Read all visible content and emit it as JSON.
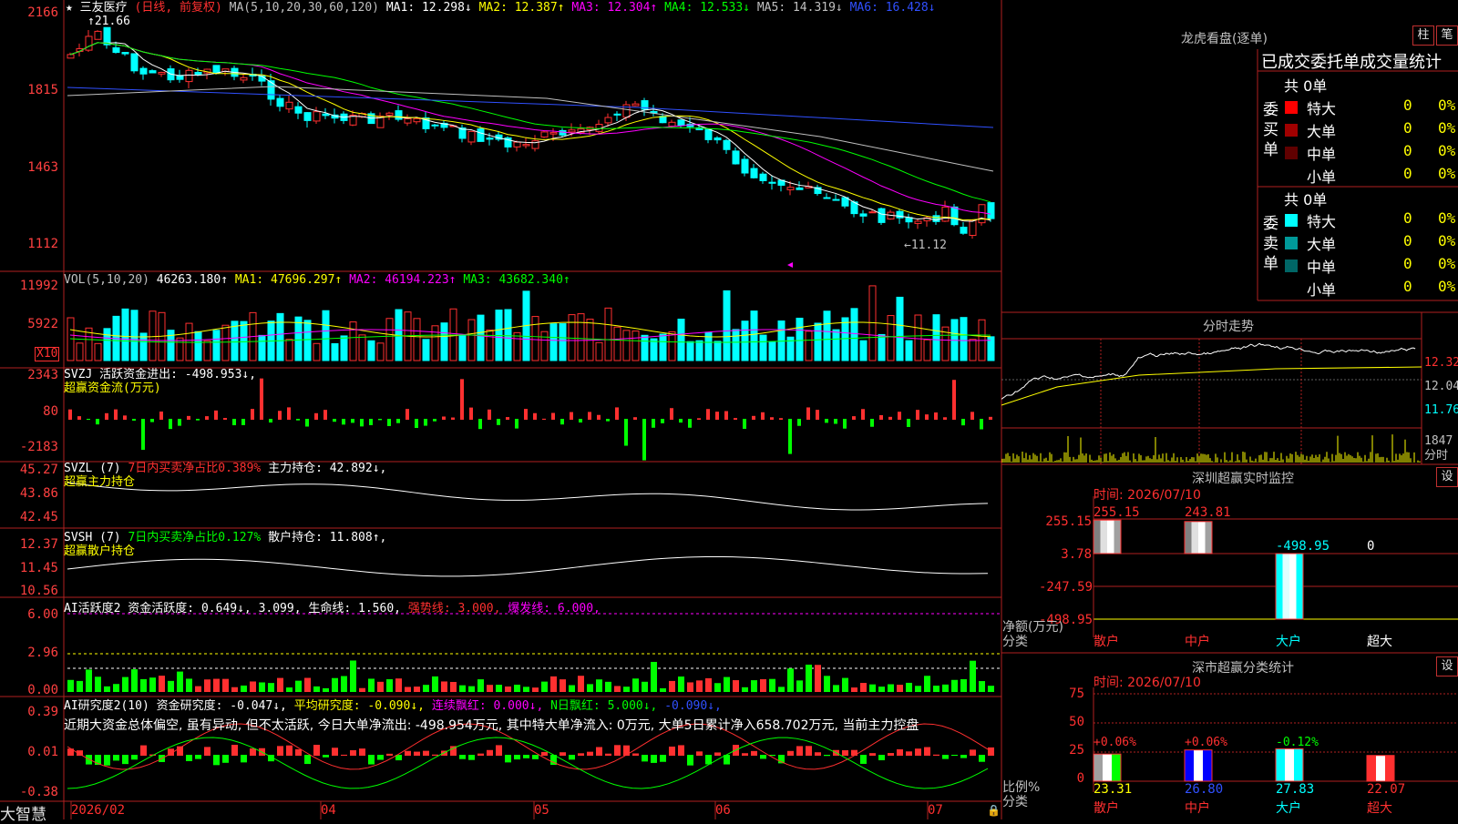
{
  "app": {
    "brand": "大智慧"
  },
  "kline": {
    "stock_name": "三友医疗",
    "period": "(日线, 前复权)",
    "ma_header": "MA(5,10,20,30,60,120)",
    "ma_items": [
      {
        "text": "MA1: 12.298↓",
        "color": "#ffffff"
      },
      {
        "text": "MA2: 12.387↑",
        "color": "#ffff00"
      },
      {
        "text": "MA3: 12.304↑",
        "color": "#ff00ff"
      },
      {
        "text": "MA4: 12.533↓",
        "color": "#00ff00"
      },
      {
        "text": "MA5: 14.319↓",
        "color": "#c0c0c0"
      },
      {
        "text": "MA6: 16.428↓",
        "color": "#3050ff"
      }
    ],
    "y_ticks": [
      "2166",
      "1815",
      "1463",
      "1112"
    ],
    "high_label": "21.66",
    "low_label": "←11.12"
  },
  "vol": {
    "header": "VOL(5,10,20)",
    "value": "46263.180↑",
    "ma_items": [
      {
        "text": "MA1: 47696.297↑",
        "color": "#ffff00"
      },
      {
        "text": "MA2: 46194.223↑",
        "color": "#ff00ff"
      },
      {
        "text": "MA3: 43682.340↑",
        "color": "#00ff00"
      }
    ],
    "y_ticks": [
      "11992",
      "5922"
    ],
    "unit": "X10"
  },
  "svzj": {
    "header": "SVZJ  活跃资金进出: -498.953↓,",
    "subtitle": "超赢资金流(万元)",
    "y_ticks": [
      "2343",
      "80",
      "-2183"
    ]
  },
  "svzl": {
    "header": "SVZL (7)",
    "ratio": "7日内买卖净占比0.389%",
    "holding": "主力持仓: 42.892↓,",
    "subtitle": "超赢主力持仓",
    "y_ticks": [
      "45.27",
      "43.86",
      "42.45"
    ]
  },
  "svsh": {
    "header": "SVSH (7)",
    "ratio": "7日内买卖净占比0.127%",
    "holding": "散户持仓: 11.808↑,",
    "subtitle": "超赢散户持仓",
    "y_ticks": [
      "12.37",
      "11.45",
      "10.56"
    ]
  },
  "ai_active": {
    "header": "AI活跃度2 资金活跃度: 0.649↓, 3.099, 生命线: 1.560,",
    "strong": "强势线: 3.000,",
    "burst": "爆发线: 6.000,",
    "y_ticks": [
      "6.00",
      "2.96",
      "0.00"
    ]
  },
  "ai_research": {
    "header": "AI研究度2(10) 资金研究度: -0.047↓,",
    "avg": "平均研究度: -0.090↓,",
    "consecutive": "连续飘红: 0.000↓,",
    "nday": "N日飘红: 5.000↓,",
    "extra": "-0.090↓,",
    "comment": "近期大资金总体偏空, 虽有异动, 但不太活跃, 今日大单净流出: -498.954万元, 其中特大单净流入: 0万元, 大单5日累计净入658.702万元, 当前主力控盘",
    "y_ticks": [
      "0.39",
      "0.01",
      "-0.38"
    ]
  },
  "x_axis": [
    "2026/02",
    "04",
    "05",
    "06",
    "07"
  ],
  "dragon": {
    "title": "龙虎看盘(逐单)",
    "btn1": "柱",
    "btn2": "笔",
    "subtitle": "已成交委托单成交量统计",
    "buy_side": "委买单",
    "sell_side": "委卖单",
    "buy_total": "共 0单",
    "sell_total": "共 0单",
    "buy_rows": [
      {
        "label": "特大",
        "count": "0",
        "pct": "0%",
        "color": "#ff0000"
      },
      {
        "label": "大单",
        "count": "0",
        "pct": "0%",
        "color": "#a00000"
      },
      {
        "label": "中单",
        "count": "0",
        "pct": "0%",
        "color": "#600000"
      },
      {
        "label": "小单",
        "count": "0",
        "pct": "0%",
        "color": ""
      }
    ],
    "sell_rows": [
      {
        "label": "特大",
        "count": "0",
        "pct": "0%",
        "color": "#00ffff"
      },
      {
        "label": "大单",
        "count": "0",
        "pct": "0%",
        "color": "#009999"
      },
      {
        "label": "中单",
        "count": "0",
        "pct": "0%",
        "color": "#006666"
      },
      {
        "label": "小单",
        "count": "0",
        "pct": "0%",
        "color": ""
      }
    ]
  },
  "intraday": {
    "title": "分时走势",
    "y_ticks": [
      "12.32",
      "12.04",
      "11.76"
    ],
    "vol_label": "1847",
    "vol_unit": "分时"
  },
  "sz_monitor": {
    "title": "深圳超赢实时监控",
    "btn": "设",
    "time": "时间: 2026/07/10",
    "y_ticks": [
      "255.15",
      "3.78",
      "-247.59",
      "-498.95"
    ],
    "y_unit": "净额(万元)",
    "x_unit": "分类",
    "categories": [
      "散户",
      "中户",
      "大户",
      "超大"
    ],
    "values": [
      "255.15",
      "243.81",
      "-498.95",
      "0"
    ]
  },
  "sz_class": {
    "title": "深市超赢分类统计",
    "btn": "设",
    "time": "时间: 2026/07/10",
    "y_ticks": [
      "75",
      "50",
      "25",
      "0"
    ],
    "y_unit": "比例%",
    "x_unit": "分类",
    "categories": [
      "散户",
      "中户",
      "大户",
      "超大"
    ],
    "changes": [
      "+0.06%",
      "+0.06%",
      "-0.12%",
      ""
    ],
    "values": [
      "23.31",
      "26.80",
      "27.83",
      "22.07"
    ]
  },
  "chart_data": {
    "type": "table",
    "sz_monitor_net": {
      "categories": [
        "散户",
        "中户",
        "大户",
        "超大"
      ],
      "values": [
        255.15,
        243.81,
        -498.95,
        0
      ]
    },
    "sz_class_ratio": {
      "categories": [
        "散户",
        "中户",
        "大户",
        "超大"
      ],
      "values": [
        23.31,
        26.8,
        27.83,
        22.07
      ]
    }
  }
}
